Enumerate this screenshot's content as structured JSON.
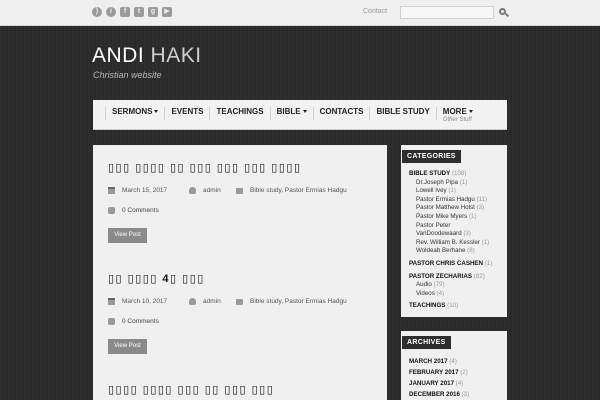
{
  "topbar": {
    "social_icons": [
      "rss-icon",
      "info-icon",
      "facebook-icon",
      "twitter-icon",
      "google-plus-icon",
      "youtube-icon"
    ],
    "contact_label": "Contact",
    "search_placeholder": ""
  },
  "header": {
    "title_first": "ANDI",
    "title_second": "HAKI",
    "tagline": "Christian website"
  },
  "nav": [
    {
      "label": "SERMONS",
      "dropdown": true,
      "sub": ""
    },
    {
      "label": "EVENTS",
      "dropdown": false,
      "sub": ""
    },
    {
      "label": "TEACHINGS",
      "dropdown": false,
      "sub": ""
    },
    {
      "label": "BIBLE",
      "dropdown": true,
      "sub": ""
    },
    {
      "label": "CONTACTS",
      "dropdown": false,
      "sub": ""
    },
    {
      "label": "BIBLE STUDY",
      "dropdown": false,
      "sub": ""
    },
    {
      "label": "MORE",
      "dropdown": true,
      "sub": "Other Stuff"
    }
  ],
  "posts": [
    {
      "title": "▯▯▯ ▯▯▯▯ ▯▯ ▯▯▯ ▯▯▯ ▯▯▯ ▯▯▯▯",
      "date": "March 15, 2017",
      "author": "admin",
      "category": "Bible study, Pastor Ermias Hadgu",
      "comments": "0 Comments",
      "button": "View Post"
    },
    {
      "title": "▯▯ ▯▯▯▯ 4▯ ▯▯▯",
      "date": "March 10, 2017",
      "author": "admin",
      "category": "Bible study, Pastor Ermias Hadgu",
      "comments": "0 Comments",
      "button": "View Post"
    },
    {
      "title": "▯▯▯▯ ▯▯▯▯ ▯▯▯ ▯▯ ▯▯▯ ▯▯▯",
      "date": "",
      "author": "",
      "category": "",
      "comments": "",
      "button": ""
    }
  ],
  "sidebar": {
    "categories_title": "CATEGORIES",
    "categories": [
      {
        "name": "BIBLE STUDY",
        "count": "(108)",
        "level": 0
      },
      {
        "name": "Dr.Joseph Pipa",
        "count": "(1)",
        "level": 1
      },
      {
        "name": "Lowell Ivey",
        "count": "(1)",
        "level": 1
      },
      {
        "name": "Pastor Ermias Hadgu",
        "count": "(11)",
        "level": 1
      },
      {
        "name": "Pastor Matthew Holst",
        "count": "(3)",
        "level": 1
      },
      {
        "name": "Pastor Mike Myers",
        "count": "(1)",
        "level": 1
      },
      {
        "name": "Pastor Peter",
        "count": "",
        "level": 1
      },
      {
        "name": "VanDoodewaard",
        "count": "(3)",
        "level": 1
      },
      {
        "name": "Rev. William B. Kessler",
        "count": "(1)",
        "level": 1
      },
      {
        "name": "Woldeab Berhane",
        "count": "(8)",
        "level": 1
      },
      {
        "name": "PASTOR CHRIS CASHEN",
        "count": "(1)",
        "level": 0
      },
      {
        "name": "PASTOR ZECHARIAS",
        "count": "(82)",
        "level": 0
      },
      {
        "name": "Audio",
        "count": "(79)",
        "level": 1
      },
      {
        "name": "Videos",
        "count": "(4)",
        "level": 1
      },
      {
        "name": "TEACHINGS",
        "count": "(10)",
        "level": 0
      }
    ],
    "archives_title": "ARCHIVES",
    "archives": [
      {
        "name": "MARCH 2017",
        "count": "(4)"
      },
      {
        "name": "FEBRUARY 2017",
        "count": "(2)"
      },
      {
        "name": "JANUARY 2017",
        "count": "(4)"
      },
      {
        "name": "DECEMBER 2016",
        "count": "(3)"
      }
    ]
  }
}
